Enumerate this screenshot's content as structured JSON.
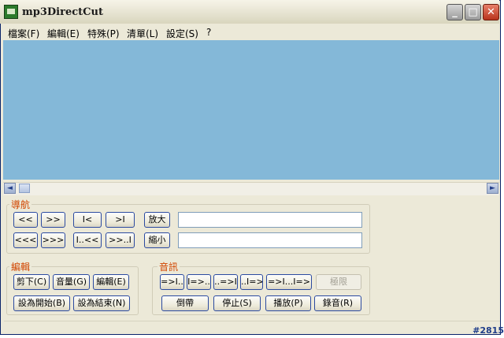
{
  "window": {
    "title": "mp3DirectCut"
  },
  "menu": [
    "檔案(F)",
    "編輯(E)",
    "特殊(P)",
    "清單(L)",
    "設定(S)",
    "?"
  ],
  "titlebar_buttons": {
    "minimize": "_",
    "maximize": "□",
    "close": "✕"
  },
  "scrollbar": {
    "left_arrow": "◄",
    "right_arrow": "►"
  },
  "nav": {
    "label": "導航",
    "row1": [
      "<<",
      ">>",
      "I<",
      ">I"
    ],
    "row2": [
      "<<<",
      ">>>",
      "I..<<",
      ">>..I"
    ],
    "zoom_in": "放大",
    "zoom_out": "縮小",
    "field1_value": "",
    "field2_value": ""
  },
  "edit": {
    "label": "編輯",
    "cut": "剪下(C)",
    "volume": "音量(G)",
    "edit": "編輯(E)",
    "set_begin": "設為開始(B)",
    "set_end": "設為結束(N)"
  },
  "audio": {
    "label": "音訊",
    "row1": [
      "=>I..",
      "I=>..",
      "..=>I",
      "..I=>",
      "=>I...I=>"
    ],
    "limit": "極限",
    "rewind": "倒帶",
    "stop": "停止(S)",
    "play": "播放(P)",
    "record": "錄音(R)"
  },
  "status_code": "#2815"
}
